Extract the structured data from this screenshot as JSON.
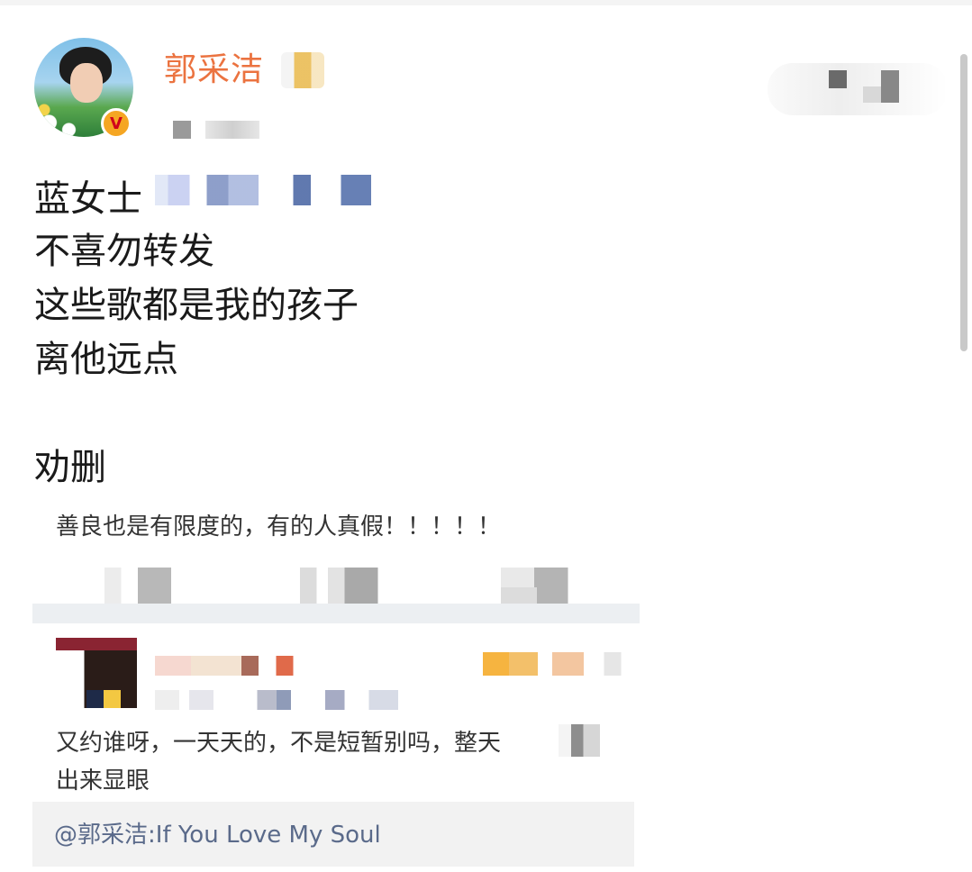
{
  "post": {
    "author": "郭采洁",
    "verified_badge": "V",
    "lines": [
      "蓝女士",
      "不喜勿转发",
      "这些歌都是我的孩子",
      "离他远点",
      "劝删"
    ]
  },
  "quoted": {
    "text": "善良也是有限度的，有的人真假！！！！！"
  },
  "comment": {
    "line1": "又约谁呀，一天天的，不是短暂别吗，整天",
    "line2": "出来显眼"
  },
  "repost": {
    "mention": "@郭采洁",
    "text": ":If You Love My Soul"
  },
  "colors": {
    "username": "#eb7340",
    "mention": "#5a6a8a",
    "badge_bg": "#f5a623"
  }
}
